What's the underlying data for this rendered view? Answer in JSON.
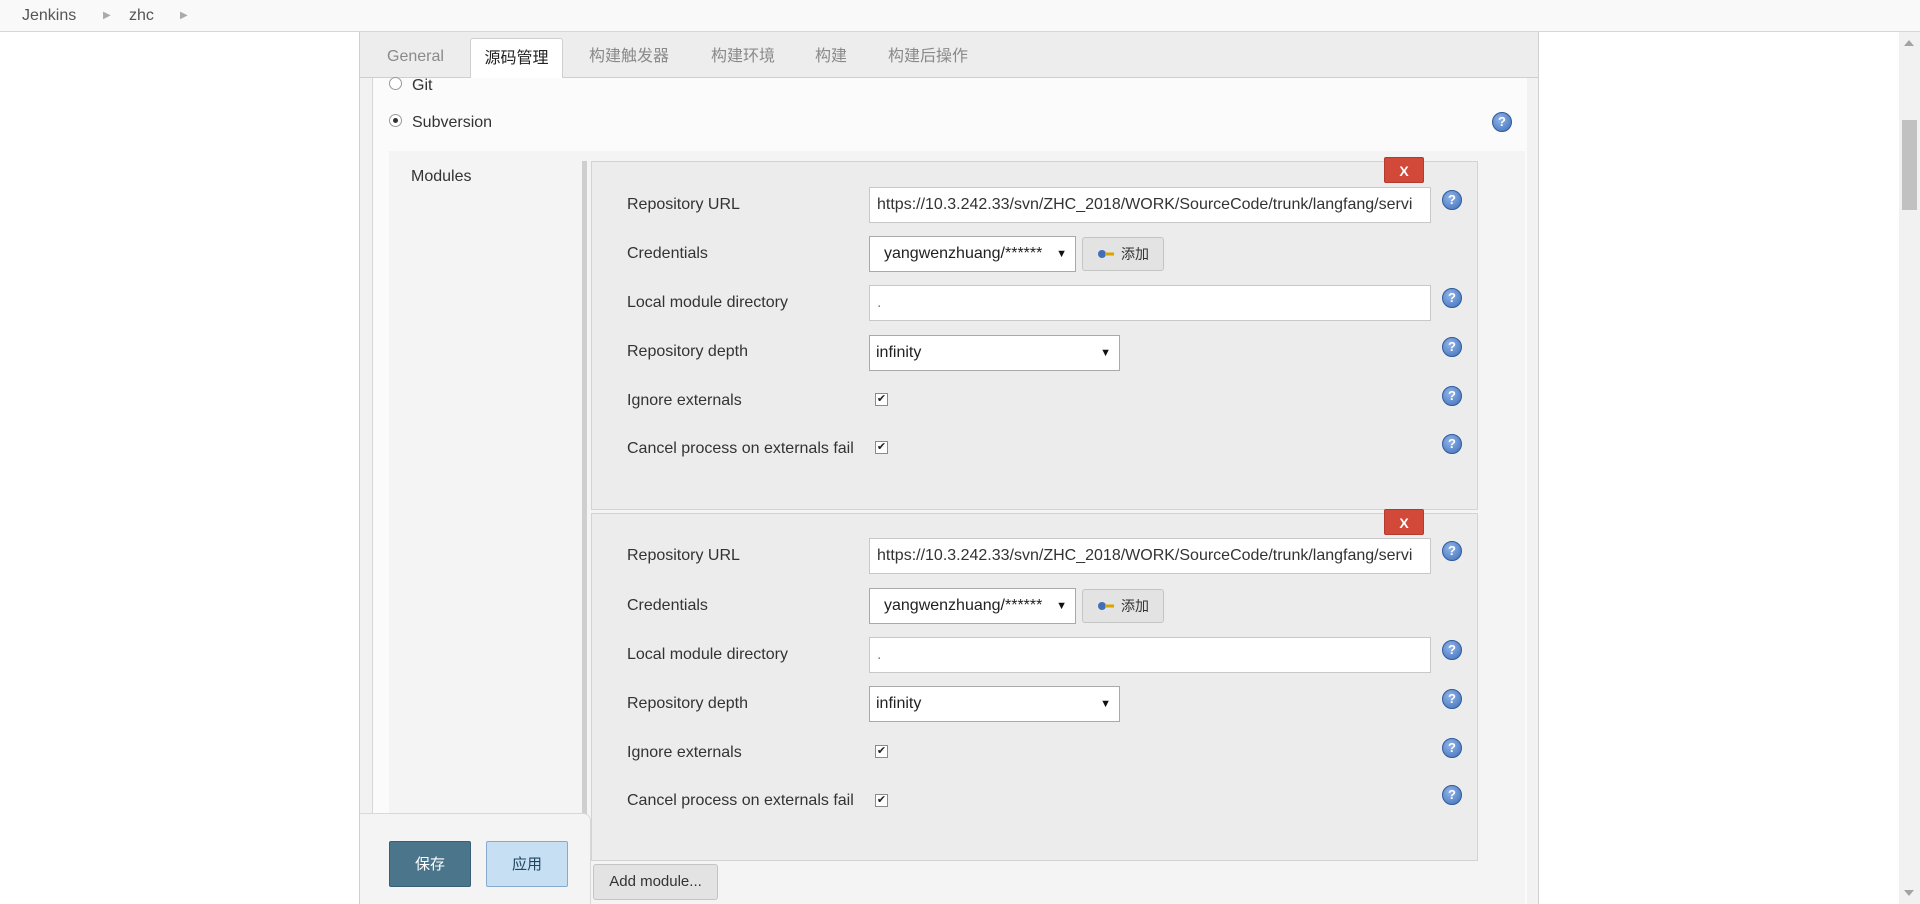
{
  "breadcrumb": {
    "items": [
      "Jenkins",
      "zhc"
    ]
  },
  "tabs": [
    {
      "label": "General",
      "active": false
    },
    {
      "label": "源码管理",
      "active": true
    },
    {
      "label": "构建触发器",
      "active": false
    },
    {
      "label": "构建环境",
      "active": false
    },
    {
      "label": "构建",
      "active": false
    },
    {
      "label": "构建后操作",
      "active": false
    }
  ],
  "scm": {
    "git_label": "Git",
    "subversion_label": "Subversion",
    "selected": "Subversion",
    "modules_label": "Modules"
  },
  "modules": [
    {
      "delete_label": "X",
      "repository_url_label": "Repository URL",
      "repository_url": "https://10.3.242.33/svn/ZHC_2018/WORK/SourceCode/trunk/langfang/servi",
      "credentials_label": "Credentials",
      "credentials_value": "yangwenzhuang/******",
      "add_credentials_label": "添加",
      "local_dir_label": "Local module directory",
      "local_dir_value": ".",
      "depth_label": "Repository depth",
      "depth_value": "infinity",
      "ignore_externals_label": "Ignore externals",
      "ignore_externals_checked": true,
      "cancel_on_fail_label": "Cancel process on externals fail",
      "cancel_on_fail_checked": true
    },
    {
      "delete_label": "X",
      "repository_url_label": "Repository URL",
      "repository_url": "https://10.3.242.33/svn/ZHC_2018/WORK/SourceCode/trunk/langfang/servi",
      "credentials_label": "Credentials",
      "credentials_value": "yangwenzhuang/******",
      "add_credentials_label": "添加",
      "local_dir_label": "Local module directory",
      "local_dir_value": ".",
      "depth_label": "Repository depth",
      "depth_value": "infinity",
      "ignore_externals_label": "Ignore externals",
      "ignore_externals_checked": true,
      "cancel_on_fail_label": "Cancel process on externals fail",
      "cancel_on_fail_checked": true
    }
  ],
  "actions": {
    "save_label": "保存",
    "apply_label": "应用",
    "add_module_label": "Add module..."
  },
  "icons": {
    "help": "help-icon",
    "key": "key-icon",
    "caret": "chevron-down-icon"
  },
  "colors": {
    "save_bg": "#4b758b",
    "apply_bg": "#c6dff2",
    "delete_bg": "#d24939",
    "help_blue": "#3f6fb8"
  }
}
